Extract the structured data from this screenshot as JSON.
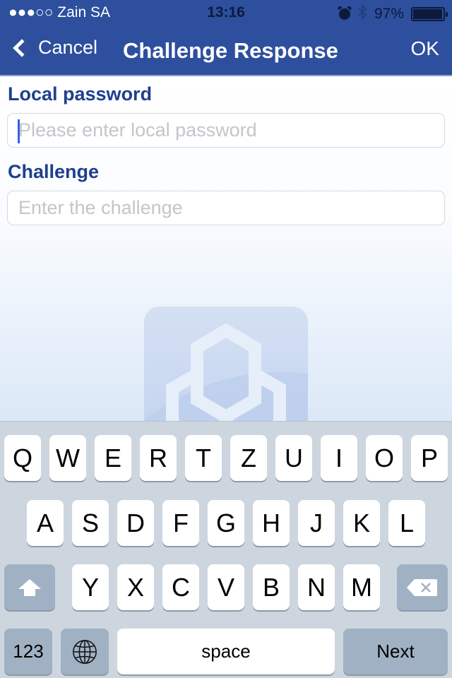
{
  "status_bar": {
    "signal": "●●●○○",
    "carrier": "Zain SA",
    "time": "13:16",
    "bluetooth_glyph": "✱",
    "battery": "97%",
    "battery_level": 0.97
  },
  "nav": {
    "back_label": "Cancel",
    "title": "Challenge Response",
    "ok_label": "OK"
  },
  "form": {
    "password": {
      "label": "Local password",
      "placeholder": "Please enter local password",
      "value": ""
    },
    "challenge": {
      "label": "Challenge",
      "placeholder": "Enter the challenge",
      "value": ""
    }
  },
  "keyboard": {
    "row1": [
      "Q",
      "W",
      "E",
      "R",
      "T",
      "Z",
      "U",
      "I",
      "O",
      "P"
    ],
    "row2": [
      "A",
      "S",
      "D",
      "F",
      "G",
      "H",
      "J",
      "K",
      "L"
    ],
    "row3": [
      "Y",
      "X",
      "C",
      "V",
      "B",
      "N",
      "M"
    ],
    "numbers_label": "123",
    "space_label": "space",
    "return_label": "Next"
  },
  "colors": {
    "nav_bg": "#2d4f9e",
    "label": "#1f3f8f",
    "keyboard_bg": "#cdd6df",
    "func_key": "#a0b1c3"
  }
}
